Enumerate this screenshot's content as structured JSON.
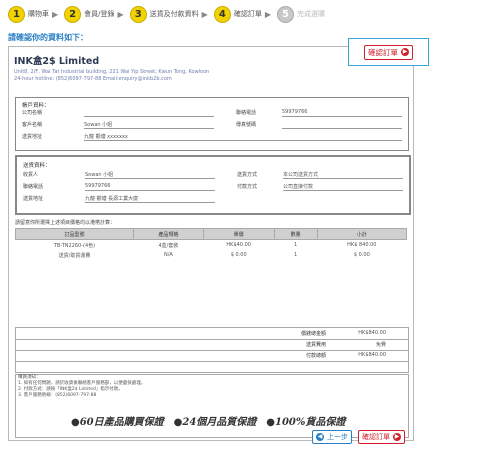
{
  "steps": [
    {
      "num": "1",
      "label": "購物車"
    },
    {
      "num": "2",
      "label": "會員/登錄"
    },
    {
      "num": "3",
      "label": "送貨及付款資料"
    },
    {
      "num": "4",
      "label": "確認訂單"
    },
    {
      "num": "5",
      "label": "完成選購"
    }
  ],
  "heading": "請確認你的資料如下：",
  "company": {
    "name": "INK盒2$ Limited",
    "address": "Unit8, 2/F, Wai Tat Industrial building, 221 Wai Yip Street, Kwun Tong, Kowloon",
    "hotline": "24-hour hotline: (852)6097-797-88    Email:enquiry@inkb2b.com"
  },
  "confirm_label": "確認訂單",
  "customer": {
    "title": "帳戶資料：",
    "company_label": "公司名稱",
    "company_value": "",
    "contact_label": "聯絡電話",
    "contact_value": "59979766",
    "name_label": "客戶名稱",
    "name_value": "Sowan 小姐",
    "email_label": "傳真號碼",
    "email_value": "",
    "address_label": "送貨地址",
    "address_value": "九龍 觀塘 xxxxxxx"
  },
  "delivery": {
    "title": "送貨資料：",
    "recipient_label": "收貨人",
    "recipient_value": "Sowan 小姐",
    "phone_label": "聯絡電話",
    "phone_value": "59979766",
    "address_label": "送貨地址",
    "address_value": "九龍 觀塘 長源工業大廈",
    "method_label": "送貨方式",
    "method_value": "本公司送貨方式",
    "pay_label": "付款方式",
    "pay_value": "公司直接付款"
  },
  "order_note": "請留意你所選擇上述項目價格均以港幣計算：",
  "items": {
    "headers": [
      "訂品型號",
      "產品規格",
      "單價",
      "數量",
      "小計"
    ],
    "rows": [
      [
        "TB-TN2260-(4色)",
        "4盒/套裝",
        "HK$40.00",
        "1",
        "HK$ 840.00"
      ],
      [
        "送貨/取貨運費",
        "N/A",
        "$ 0.00",
        "1",
        "$ 0.00"
      ]
    ]
  },
  "summary": [
    {
      "k": "價錢總金額",
      "v": "HK$840.00"
    },
    {
      "k": "送貨費用",
      "v": "免費"
    },
    {
      "k": "付款總額",
      "v": "HK$840.00"
    }
  ],
  "remarks": [
    "購買須知：",
    "1. 如有任何問題，請於收貨後聯絡客戶服務部，以便盡快處理。",
    "2. 付款方式：請按「INK盒2$ Limited」指示付款。",
    "3. 客戶服務熱線：(852)6097-797-88"
  ],
  "guarantee": "●60日產品購買保證　●24個月品質保證　●100%貨品保證",
  "back_label": "上一步",
  "confirm_bottom_label": "確認訂單"
}
